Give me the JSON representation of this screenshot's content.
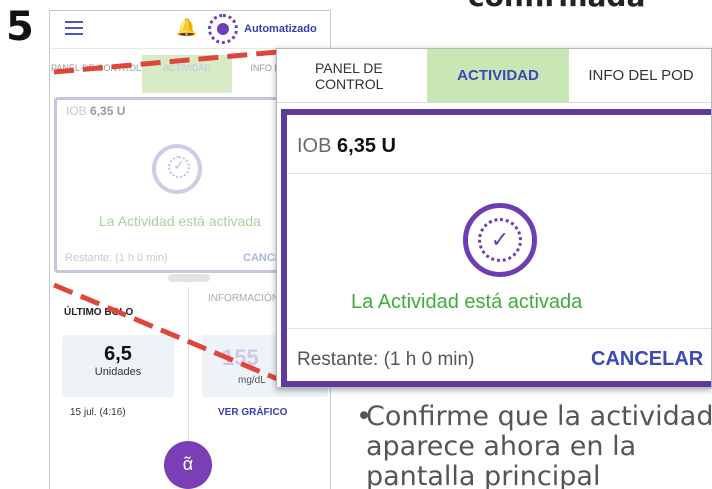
{
  "step_number": "5",
  "heading_fragment": "confirmada",
  "phone": {
    "header": {
      "mode_label": "Automatizado"
    },
    "tabs": [
      "PANEL DE CONTROL",
      "ACTIVIDAD",
      "INFO DEL POD"
    ],
    "activity_card": {
      "iob_label": "IOB",
      "iob_value": "6,35 U",
      "status_text": "La Actividad está activada",
      "remaining_text": "Restante: (1 h 0 min)",
      "cancel_label": "CANCELAR"
    },
    "last_bolus": {
      "title": "ÚLTIMO BOLO",
      "value": "6,5",
      "unit": "Unidades",
      "date": "15 jul. (4:16)"
    },
    "sensor": {
      "title": "INFORMACIÓN SENSOR",
      "value": "155",
      "unit": "mg/dL",
      "graph_link": "VER GRÁFICO"
    },
    "fab_icon": "bolus-icon"
  },
  "zoom": {
    "tabs": [
      "PANEL DE CONTROL",
      "ACTIVIDAD",
      "INFO DEL POD"
    ],
    "iob_label": "IOB",
    "iob_value": "6,35 U",
    "status_text": "La Actividad está activada",
    "remaining_text": "Restante: (1 h 0 min)",
    "cancel_label": "CANCELAR"
  },
  "instruction": {
    "line1": "Confirme que la actividad",
    "line2": "aparece ahora en la",
    "line3": "pantalla principal"
  },
  "colors": {
    "accent_purple": "#5c3a9e",
    "active_tab_green": "#c9e7b4",
    "status_green": "#3fad3a",
    "link_blue": "#3b48b8",
    "callout_red": "#e0453a"
  }
}
